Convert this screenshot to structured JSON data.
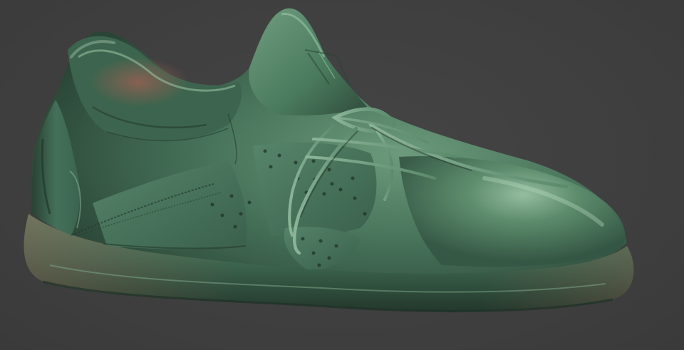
{
  "viewport": {
    "background_color": "#404040",
    "model": {
      "subject": "sneaker",
      "material_colors": {
        "base": "#3f6a52",
        "highlight": "#8fb79a",
        "warm_tint": "#8a5a4c",
        "shadow": "#1f3329"
      }
    }
  }
}
